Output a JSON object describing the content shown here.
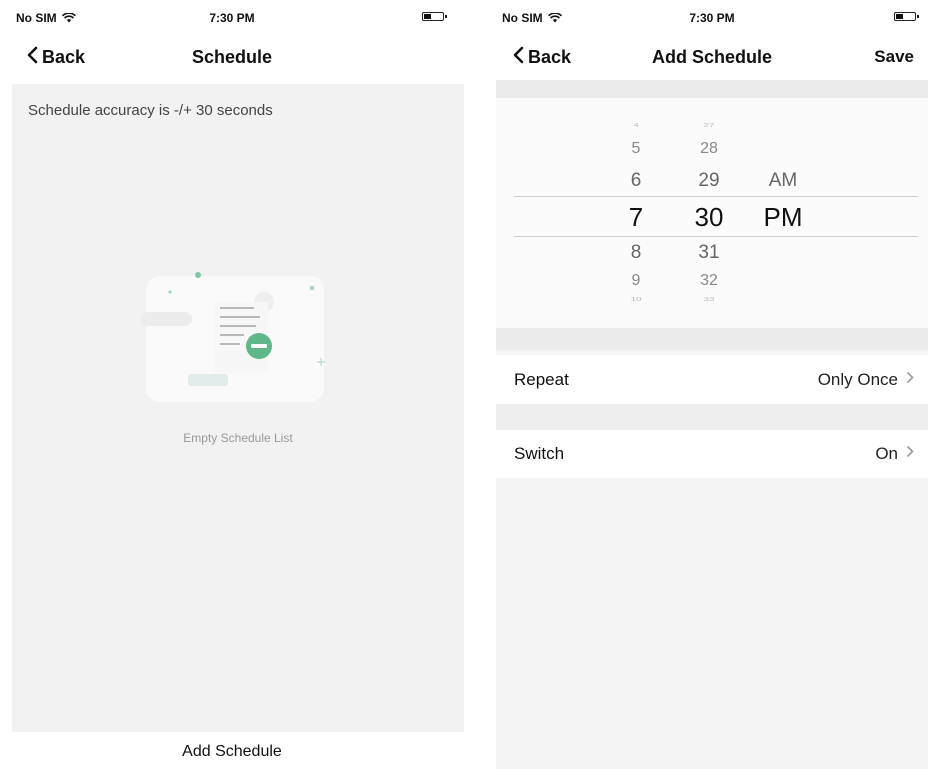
{
  "left_screen": {
    "status": {
      "carrier": "No SIM",
      "time": "7:30 PM"
    },
    "nav": {
      "back": "Back",
      "title": "Schedule"
    },
    "accuracy_note": "Schedule accuracy is -/+ 30 seconds",
    "empty_label": "Empty Schedule List",
    "bottom_button": "Add Schedule"
  },
  "right_screen": {
    "status": {
      "carrier": "No SIM",
      "time": "7:30 PM"
    },
    "nav": {
      "back": "Back",
      "title": "Add Schedule",
      "save": "Save"
    },
    "picker": {
      "hours": [
        "4",
        "5",
        "6",
        "7",
        "8",
        "9",
        "10"
      ],
      "minutes": [
        "27",
        "28",
        "29",
        "30",
        "31",
        "32",
        "33"
      ],
      "ampm": [
        "AM",
        "PM"
      ],
      "selected": {
        "hour": "7",
        "minute": "30",
        "period": "PM"
      }
    },
    "repeat": {
      "label": "Repeat",
      "value": "Only Once"
    },
    "switch": {
      "label": "Switch",
      "value": "On"
    }
  },
  "colors": {
    "accent_green": "#5fb88a",
    "background": "#f2f2f2"
  }
}
